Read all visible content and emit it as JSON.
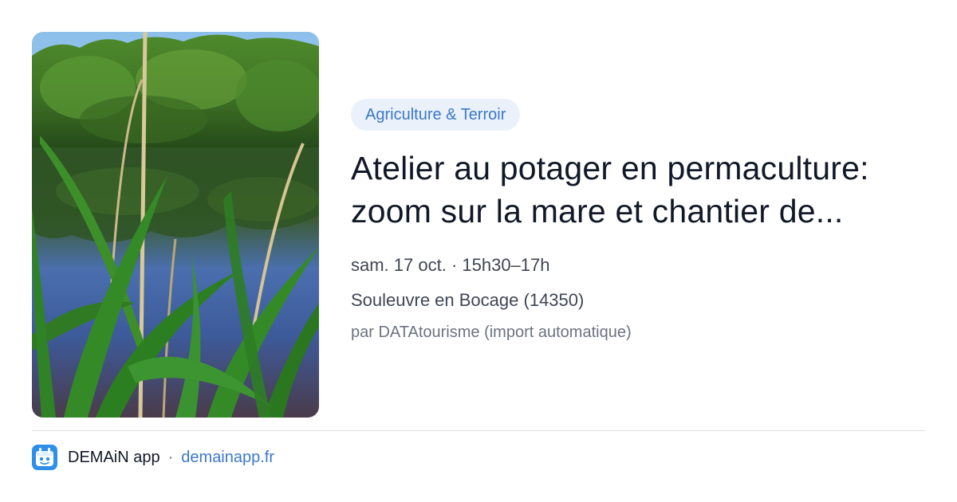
{
  "event": {
    "category": "Agriculture & Terroir",
    "title_line1": "Atelier au potager en permaculture:",
    "title_line2": "zoom sur la mare et chantier de...",
    "datetime": "sam. 17 oct. · 15h30–17h",
    "location": "Souleuvre en Bocage (14350)",
    "source": "par DATAtourisme (import automatique)",
    "image": "pond-with-reeds-photo"
  },
  "footer": {
    "app_name": "DEMAiN app",
    "separator": "·",
    "url": "demainapp.fr",
    "icon": "demain-app-logo-icon"
  },
  "colors": {
    "accent": "#3b78c8",
    "badge_bg": "#eaf1fb",
    "title": "#111827",
    "meta": "#3f4654",
    "muted": "#6b7280"
  }
}
